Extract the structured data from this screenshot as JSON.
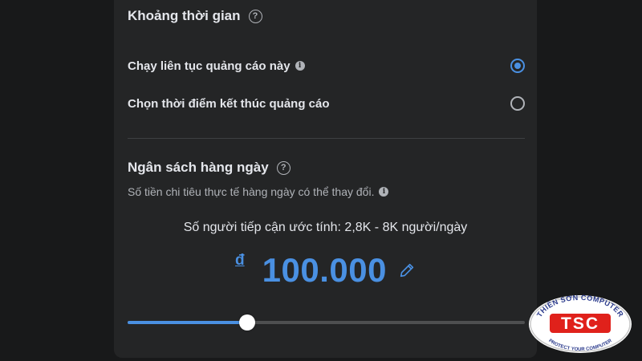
{
  "duration": {
    "title": "Khoảng thời gian",
    "help_icon": "question-circle-icon",
    "options": [
      {
        "label": "Chạy liên tục quảng cáo này",
        "has_info": true,
        "selected": true
      },
      {
        "label": "Chọn thời điểm kết thúc quảng cáo",
        "has_info": false,
        "selected": false
      }
    ]
  },
  "budget": {
    "title": "Ngân sách hàng ngày",
    "help_icon": "question-circle-icon",
    "subtitle": "Số tiền chi tiêu thực tế hàng ngày có thể thay đổi.",
    "reach": "Số người tiếp cận ước tính: 2,8K - 8K người/ngày",
    "currency_symbol": "đ",
    "amount": "100.000",
    "edit_icon": "pencil-icon",
    "slider_fraction": 0.3
  },
  "watermark": {
    "name": "THIÊN SƠN COMPUTER",
    "initials": "TSC",
    "tagline": "PROTECT YOUR COMPUTER"
  },
  "colors": {
    "background": "#18191a",
    "panel": "#242526",
    "accent": "#4a90e2",
    "text_primary": "#e4e6eb",
    "text_secondary": "#b0b3b8",
    "logo_red": "#e0211b",
    "logo_blue": "#2a3a8c"
  }
}
